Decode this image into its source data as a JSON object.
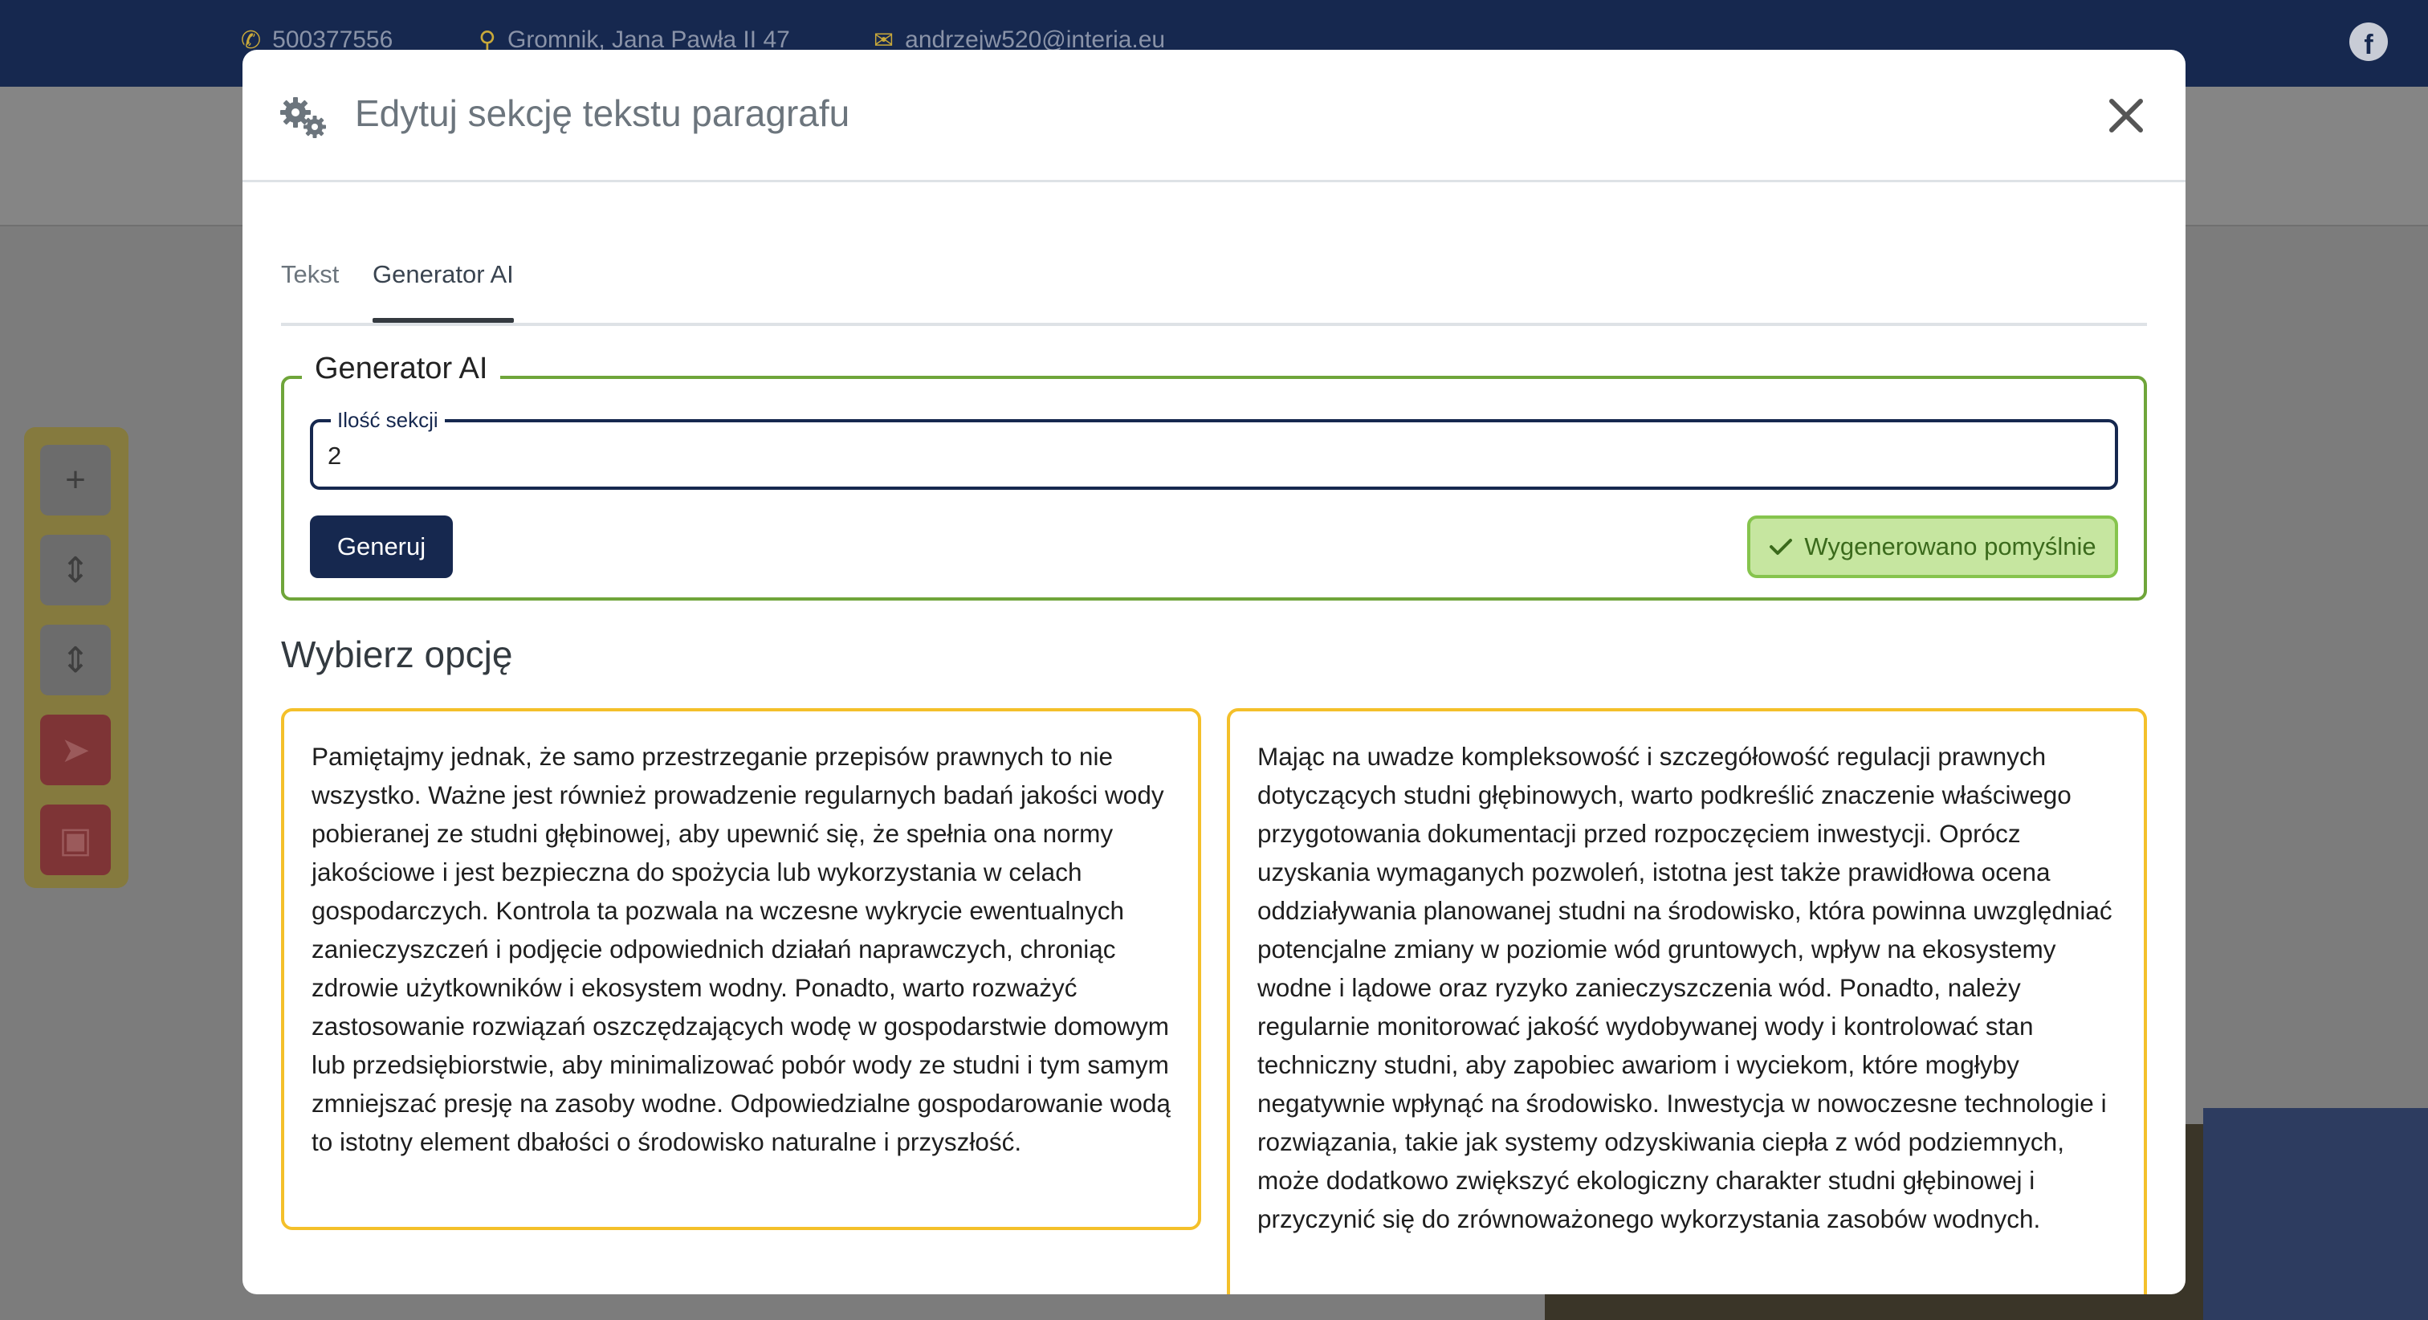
{
  "background": {
    "topbar": {
      "phone": "500377556",
      "address": "Gromnik, Jana Pawła II 47",
      "email": "andrzejw520@interia.eu",
      "facebook_icon": "facebook-icon"
    },
    "side_toolbar": {
      "buttons": [
        "plus-icon",
        "sort-down-icon",
        "sort-up-icon",
        "send-icon",
        "trash-icon"
      ]
    }
  },
  "modal": {
    "title": "Edytuj sekcję tekstu paragrafu",
    "title_icon": "gears-icon",
    "close_icon": "close-icon",
    "tabs": [
      {
        "label": "Tekst",
        "active": false
      },
      {
        "label": "Generator AI",
        "active": true
      }
    ],
    "generator": {
      "legend": "Generator AI",
      "count_label": "Ilość sekcji",
      "count_value": "2",
      "generate_label": "Generuj",
      "status_text": "Wygenerowano pomyślnie",
      "status_icon": "check-icon"
    },
    "options_heading": "Wybierz opcję",
    "options": [
      "Pamiętajmy jednak, że samo przestrzeganie przepisów prawnych to nie wszystko. Ważne jest również prowadzenie regularnych badań jakości wody pobieranej ze studni głębinowej, aby upewnić się, że spełnia ona normy jakościowe i jest bezpieczna do spożycia lub wykorzystania w celach gospodarczych. Kontrola ta pozwala na wczesne wykrycie ewentualnych zanieczyszczeń i podjęcie odpowiednich działań naprawczych, chroniąc zdrowie użytkowników i ekosystem wodny. Ponadto, warto rozważyć zastosowanie rozwiązań oszczędzających wodę w gospodarstwie domowym lub przedsiębiorstwie, aby minimalizować pobór wody ze studni i tym samym zmniejszać presję na zasoby wodne. Odpowiedzialne gospodarowanie wodą to istotny element dbałości o środowisko naturalne i przyszłość.",
      "Mając na uwadze kompleksowość i szczegółowość regulacji prawnych dotyczących studni głębinowych, warto podkreślić znaczenie właściwego przygotowania dokumentacji przed rozpoczęciem inwestycji. Oprócz uzyskania wymaganych pozwoleń, istotna jest także prawidłowa ocena oddziaływania planowanej studni na środowisko, która powinna uwzględniać potencjalne zmiany w poziomie wód gruntowych, wpływ na ekosystemy wodne i lądowe oraz ryzyko zanieczyszczenia wód. Ponadto, należy regularnie monitorować jakość wydobywanej wody i kontrolować stan techniczny studni, aby zapobiec awariom i wyciekom, które mogłyby negatywnie wpłynąć na środowisko. Inwestycja w nowoczesne technologie i rozwiązania, takie jak systemy odzyskiwania ciepła z wód podziemnych, może dodatkowo zwiększyć ekologiczny charakter studni głębinowej i przyczynić się do zrównoważonego wykorzystania zasobów wodnych."
    ]
  },
  "colors": {
    "navy": "#16284f",
    "success_green": "#86c44d",
    "option_border": "#f4c02a",
    "fieldset_border": "#6fa53a"
  }
}
